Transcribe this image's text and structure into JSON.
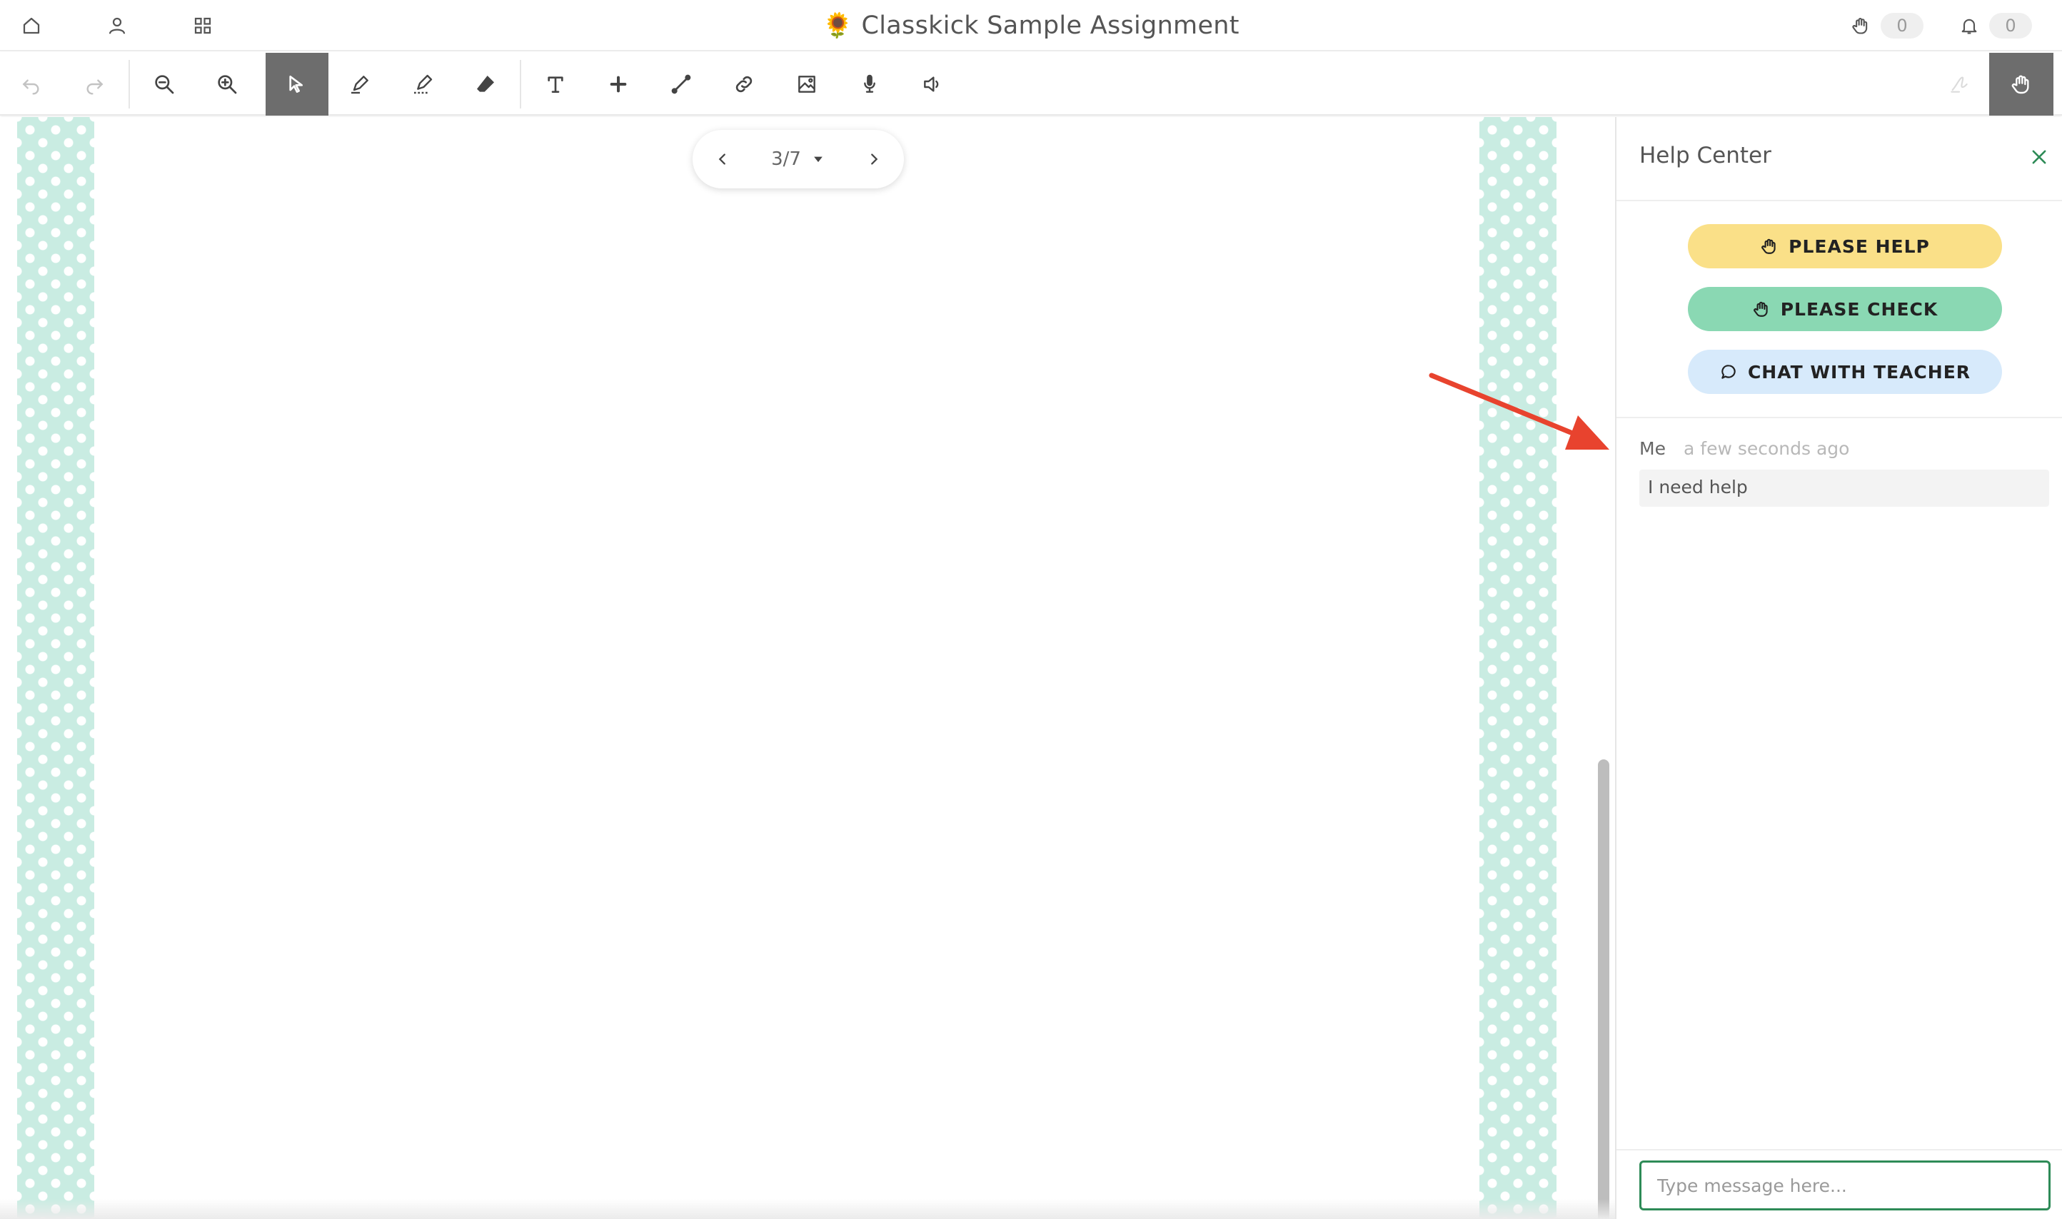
{
  "header": {
    "title_emoji": "🌻",
    "title": "Classkick Sample Assignment",
    "nav_icons": [
      "home-icon",
      "profile-icon",
      "grid-icon"
    ],
    "help_counter": "0",
    "notification_counter": "0"
  },
  "toolbar": {
    "tools": [
      "undo-icon",
      "redo-icon",
      "zoom-out-icon",
      "zoom-in-icon",
      "select-icon",
      "pen-icon",
      "highlighter-icon",
      "eraser-icon",
      "text-icon",
      "add-icon",
      "line-icon",
      "link-icon",
      "image-icon",
      "microphone-icon",
      "speaker-icon",
      "signature-icon",
      "hand-raise-icon"
    ],
    "active_tool": "select-icon"
  },
  "pager": {
    "current": "3/7"
  },
  "help_panel": {
    "title": "Help Center",
    "buttons": {
      "please_help": "PLEASE HELP",
      "please_check": "PLEASE CHECK",
      "chat_with_teacher": "CHAT WITH TEACHER"
    },
    "colors": {
      "please_help": "#fae088",
      "please_check": "#8ad8b3",
      "chat_with_teacher": "#d7eafb",
      "input_border": "#2e8b57"
    },
    "messages": [
      {
        "sender": "Me",
        "time": "a few seconds ago",
        "text": "I need help"
      }
    ],
    "input_placeholder": "Type message here..."
  },
  "colors": {
    "polka_background": "#c9ece2",
    "annotation_arrow": "#e8432e",
    "active_tool_background": "#6d6d6d"
  }
}
